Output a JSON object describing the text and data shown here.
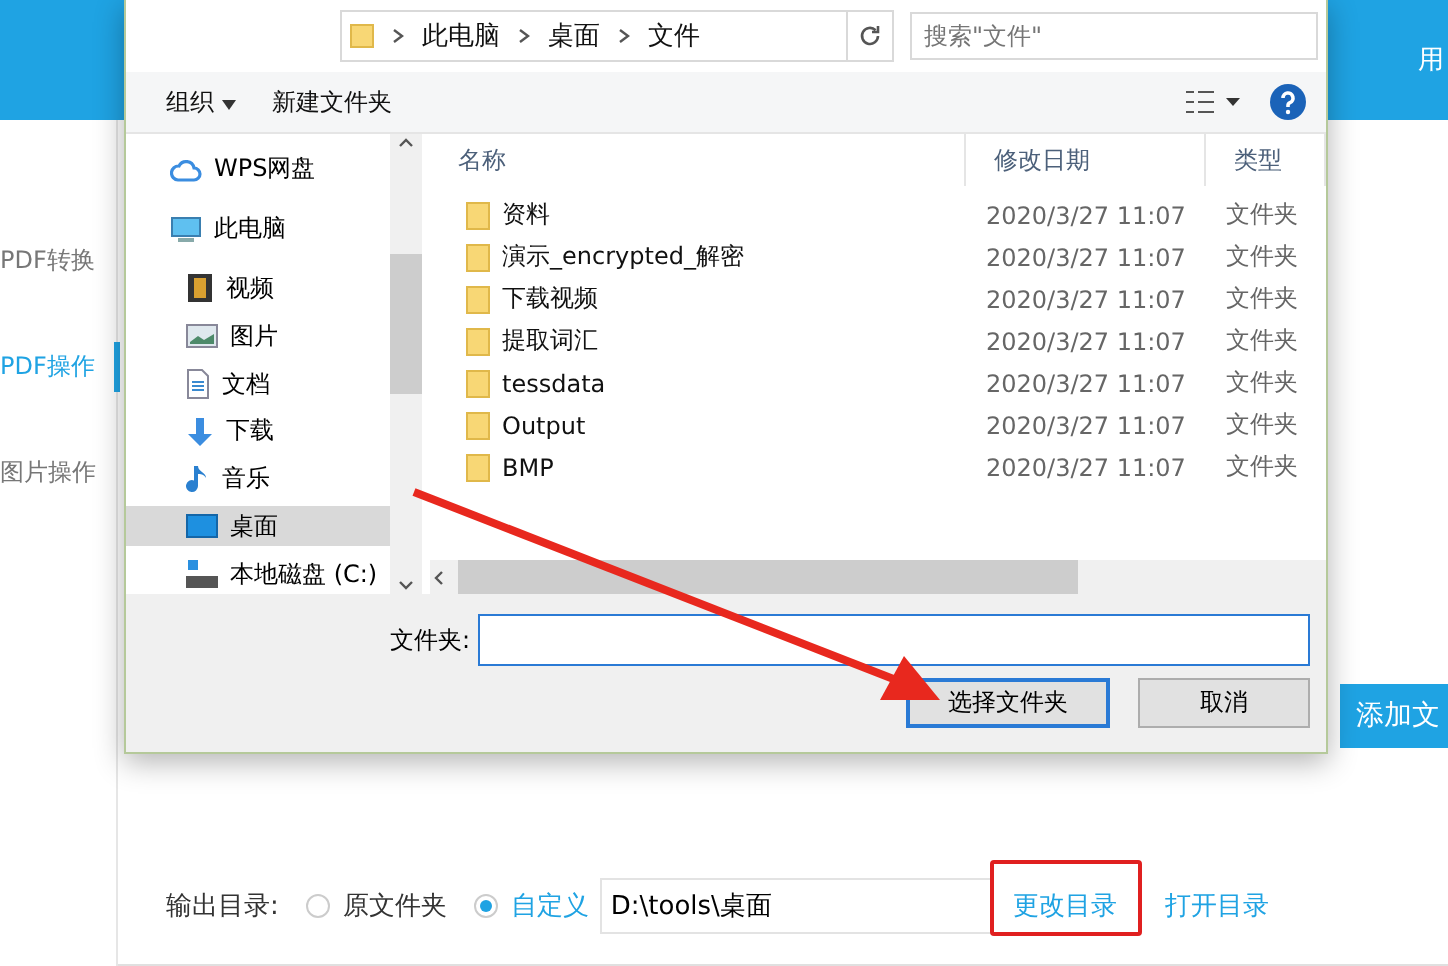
{
  "app": {
    "sidebar": [
      {
        "label": "PDF转换",
        "selected": false
      },
      {
        "label": "PDF操作",
        "selected": true
      },
      {
        "label": "图片操作",
        "selected": false
      }
    ],
    "header_right": "用",
    "add_button": "添加文",
    "output": {
      "label": "输出目录:",
      "options": [
        {
          "label": "原文件夹",
          "selected": false
        },
        {
          "label": "自定义",
          "selected": true
        }
      ],
      "path": "D:\\tools\\桌面",
      "change": "更改目录",
      "open": "打开目录"
    }
  },
  "dialog": {
    "breadcrumb": [
      "此电脑",
      "桌面",
      "文件"
    ],
    "search": {
      "placeholder": "搜索\"文件\""
    },
    "toolbar": {
      "organize": "组织",
      "new_folder": "新建文件夹"
    },
    "nav": [
      {
        "label": "WPS网盘",
        "selected": false
      },
      {
        "label": "此电脑",
        "selected": false,
        "children": [
          {
            "label": "视频",
            "selected": false
          },
          {
            "label": "图片",
            "selected": false
          },
          {
            "label": "文档",
            "selected": false
          },
          {
            "label": "下载",
            "selected": false
          },
          {
            "label": "音乐",
            "selected": false
          },
          {
            "label": "桌面",
            "selected": true
          },
          {
            "label": "本地磁盘 (C:)",
            "selected": false
          }
        ]
      }
    ],
    "columns": [
      "名称",
      "修改日期",
      "类型"
    ],
    "rows": [
      {
        "name": "资料",
        "date": "2020/3/27 11:07",
        "type": "文件夹"
      },
      {
        "name": "演示_encrypted_解密",
        "date": "2020/3/27 11:07",
        "type": "文件夹"
      },
      {
        "name": "下载视频",
        "date": "2020/3/27 11:07",
        "type": "文件夹"
      },
      {
        "name": "提取词汇",
        "date": "2020/3/27 11:07",
        "type": "文件夹"
      },
      {
        "name": "tessdata",
        "date": "2020/3/27 11:07",
        "type": "文件夹"
      },
      {
        "name": "Output",
        "date": "2020/3/27 11:07",
        "type": "文件夹"
      },
      {
        "name": "BMP",
        "date": "2020/3/27 11:07",
        "type": "文件夹"
      }
    ],
    "folder_field": {
      "label": "文件夹:"
    },
    "buttons": [
      {
        "label": "选择文件夹",
        "kind": "primary"
      },
      {
        "label": "取消",
        "kind": "normal"
      }
    ]
  }
}
